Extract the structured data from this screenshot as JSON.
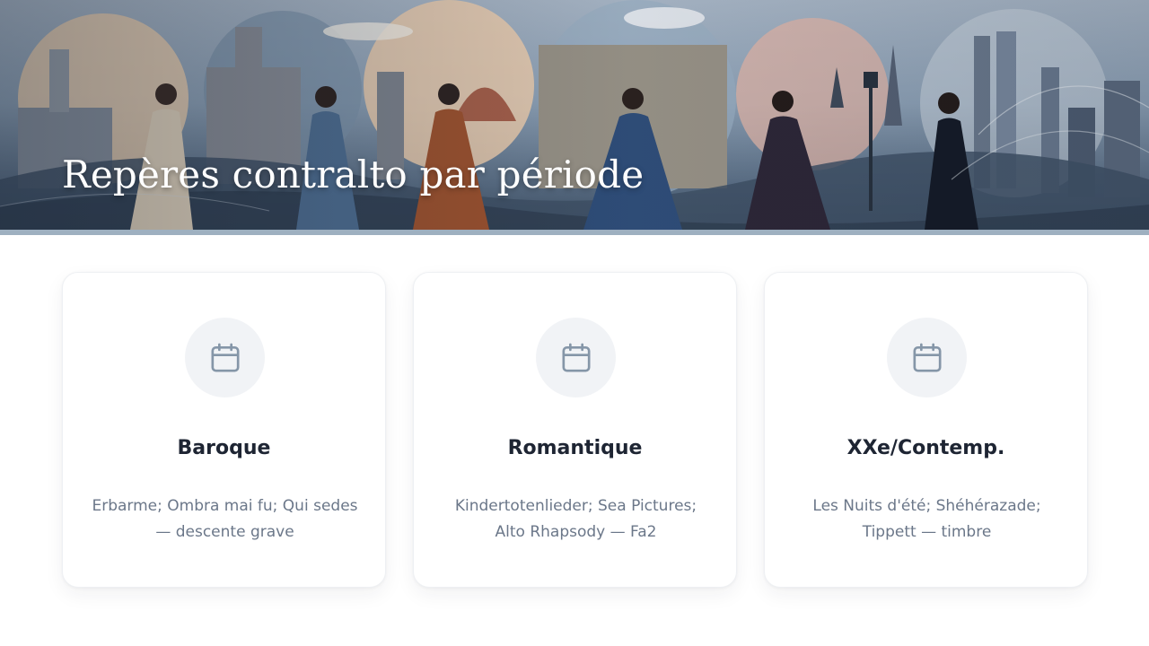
{
  "hero": {
    "title": "Repères contralto par période"
  },
  "cards": [
    {
      "icon": "calendar-icon",
      "title": "Baroque",
      "description": "Erbarme; Ombra mai fu; Qui sedes — descente grave"
    },
    {
      "icon": "calendar-icon",
      "title": "Romantique",
      "description": "Kindertotenlieder; Sea Pictures; Alto Rhapsody — Fa2"
    },
    {
      "icon": "calendar-icon",
      "title": "XXe/Contemp.",
      "description": "Les Nuits d'été; Shéhérazade; Tippett — timbre"
    }
  ],
  "colors": {
    "icon_stroke": "#8596a8",
    "icon_bg": "#f1f3f6",
    "title_text": "#1e2533",
    "body_text": "#6b7789"
  }
}
